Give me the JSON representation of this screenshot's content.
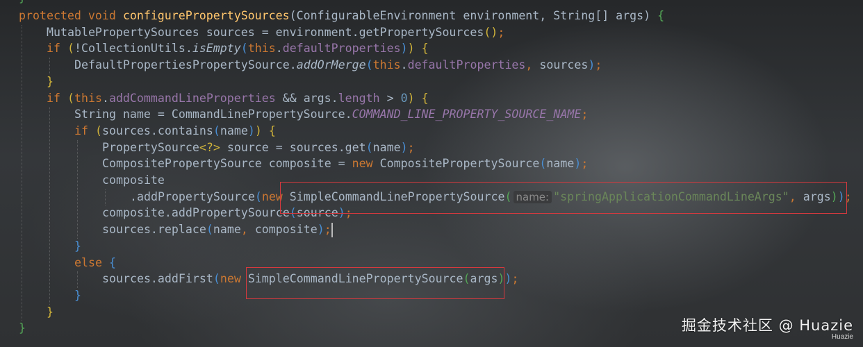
{
  "editor": {
    "top_fragment": "}",
    "lines": [
      {
        "indent": 0,
        "tokens": [
          {
            "t": "protected ",
            "k": "keyword"
          },
          {
            "t": "void ",
            "k": "keyword"
          },
          {
            "t": "configurePropertySources",
            "k": "method"
          },
          {
            "t": "(ConfigurableEnvironment environment, String[] args) ",
            "k": "plain"
          },
          {
            "t": "{",
            "k": "brace-g"
          }
        ]
      },
      {
        "indent": 1,
        "tokens": [
          {
            "t": "MutablePropertySources sources = environment.getPropertySources",
            "k": "plain"
          },
          {
            "t": "()",
            "k": "brace-y"
          },
          {
            "t": ";",
            "k": "keyword"
          }
        ]
      },
      {
        "indent": 1,
        "tokens": [
          {
            "t": "if ",
            "k": "keyword"
          },
          {
            "t": "(",
            "k": "brace-y"
          },
          {
            "t": "!CollectionUtils.",
            "k": "plain"
          },
          {
            "t": "isEmpty",
            "k": "static-call"
          },
          {
            "t": "(",
            "k": "brace-b"
          },
          {
            "t": "this",
            "k": "keyword"
          },
          {
            "t": ".",
            "k": "plain"
          },
          {
            "t": "defaultProperties",
            "k": "field"
          },
          {
            "t": ")",
            "k": "brace-b"
          },
          {
            "t": ")",
            "k": "brace-y"
          },
          {
            "t": " ",
            "k": "plain"
          },
          {
            "t": "{",
            "k": "brace-y"
          }
        ]
      },
      {
        "indent": 2,
        "tokens": [
          {
            "t": "DefaultPropertiesPropertySource.",
            "k": "plain"
          },
          {
            "t": "addOrMerge",
            "k": "static-call"
          },
          {
            "t": "(",
            "k": "brace-b"
          },
          {
            "t": "this",
            "k": "keyword"
          },
          {
            "t": ".",
            "k": "plain"
          },
          {
            "t": "defaultProperties",
            "k": "field"
          },
          {
            "t": ", ",
            "k": "keyword"
          },
          {
            "t": "sources",
            "k": "plain"
          },
          {
            "t": ")",
            "k": "brace-b"
          },
          {
            "t": ";",
            "k": "keyword"
          }
        ]
      },
      {
        "indent": 1,
        "tokens": [
          {
            "t": "}",
            "k": "brace-y"
          }
        ]
      },
      {
        "indent": 1,
        "tokens": [
          {
            "t": "if ",
            "k": "keyword"
          },
          {
            "t": "(",
            "k": "brace-y"
          },
          {
            "t": "this",
            "k": "keyword"
          },
          {
            "t": ".",
            "k": "plain"
          },
          {
            "t": "addCommandLineProperties",
            "k": "field"
          },
          {
            "t": " && args.",
            "k": "plain"
          },
          {
            "t": "length",
            "k": "field"
          },
          {
            "t": " > ",
            "k": "plain"
          },
          {
            "t": "0",
            "k": "number"
          },
          {
            "t": ")",
            "k": "brace-y"
          },
          {
            "t": " ",
            "k": "plain"
          },
          {
            "t": "{",
            "k": "brace-y"
          }
        ]
      },
      {
        "indent": 2,
        "tokens": [
          {
            "t": "String name = CommandLinePropertySource.",
            "k": "plain"
          },
          {
            "t": "COMMAND_LINE_PROPERTY_SOURCE_NAME",
            "k": "field-static"
          },
          {
            "t": ";",
            "k": "keyword"
          }
        ]
      },
      {
        "indent": 2,
        "tokens": [
          {
            "t": "if ",
            "k": "keyword"
          },
          {
            "t": "(",
            "k": "brace-y"
          },
          {
            "t": "sources.contains",
            "k": "plain"
          },
          {
            "t": "(",
            "k": "brace-b"
          },
          {
            "t": "name",
            "k": "plain"
          },
          {
            "t": ")",
            "k": "brace-b"
          },
          {
            "t": ")",
            "k": "brace-y"
          },
          {
            "t": " ",
            "k": "plain"
          },
          {
            "t": "{",
            "k": "brace-y"
          }
        ]
      },
      {
        "indent": 3,
        "tokens": [
          {
            "t": "PropertySource",
            "k": "plain"
          },
          {
            "t": "<?>",
            "k": "brace-y"
          },
          {
            "t": " source = sources.get",
            "k": "plain"
          },
          {
            "t": "(",
            "k": "brace-b"
          },
          {
            "t": "name",
            "k": "plain"
          },
          {
            "t": ")",
            "k": "brace-b"
          },
          {
            "t": ";",
            "k": "keyword"
          }
        ]
      },
      {
        "indent": 3,
        "tokens": [
          {
            "t": "CompositePropertySource composite = ",
            "k": "plain"
          },
          {
            "t": "new ",
            "k": "keyword"
          },
          {
            "t": "CompositePropertySource",
            "k": "plain"
          },
          {
            "t": "(",
            "k": "brace-b"
          },
          {
            "t": "name",
            "k": "plain"
          },
          {
            "t": ")",
            "k": "brace-b"
          },
          {
            "t": ";",
            "k": "keyword"
          }
        ]
      },
      {
        "indent": 3,
        "tokens": [
          {
            "t": "composite",
            "k": "plain"
          }
        ]
      },
      {
        "indent": 4,
        "tokens": [
          {
            "t": ".addPropertySource",
            "k": "plain"
          },
          {
            "t": "(",
            "k": "brace-b"
          },
          {
            "t": "new ",
            "k": "keyword"
          },
          {
            "t": "SimpleCommandLinePropertySource",
            "k": "plain"
          },
          {
            "t": "(",
            "k": "brace-g"
          },
          {
            "t": "name:",
            "k": "hint"
          },
          {
            "t": "\"springApplicationCommandLineArgs\"",
            "k": "string"
          },
          {
            "t": ", ",
            "k": "keyword"
          },
          {
            "t": "args",
            "k": "plain"
          },
          {
            "t": ")",
            "k": "brace-g"
          },
          {
            "t": ")",
            "k": "brace-b"
          },
          {
            "t": ";",
            "k": "keyword"
          }
        ]
      },
      {
        "indent": 3,
        "tokens": [
          {
            "t": "composite.addPropertySource",
            "k": "plain"
          },
          {
            "t": "(",
            "k": "brace-b"
          },
          {
            "t": "source",
            "k": "plain"
          },
          {
            "t": ")",
            "k": "brace-b"
          },
          {
            "t": ";",
            "k": "keyword"
          }
        ]
      },
      {
        "indent": 3,
        "tokens": [
          {
            "t": "sources.replace",
            "k": "plain"
          },
          {
            "t": "(",
            "k": "brace-b"
          },
          {
            "t": "name",
            "k": "plain"
          },
          {
            "t": ", ",
            "k": "keyword"
          },
          {
            "t": "composite",
            "k": "plain"
          },
          {
            "t": ")",
            "k": "brace-b"
          },
          {
            "t": ";",
            "k": "keyword"
          }
        ]
      },
      {
        "indent": 2,
        "tokens": [
          {
            "t": "}",
            "k": "brace-b"
          }
        ]
      },
      {
        "indent": 2,
        "tokens": [
          {
            "t": "else ",
            "k": "keyword"
          },
          {
            "t": "{",
            "k": "brace-b"
          }
        ]
      },
      {
        "indent": 3,
        "tokens": [
          {
            "t": "sources.addFirst",
            "k": "plain"
          },
          {
            "t": "(",
            "k": "brace-b"
          },
          {
            "t": "new ",
            "k": "keyword"
          },
          {
            "t": "SimpleCommandLinePropertySource",
            "k": "plain"
          },
          {
            "t": "(",
            "k": "brace-g"
          },
          {
            "t": "args",
            "k": "plain"
          },
          {
            "t": ")",
            "k": "brace-g"
          },
          {
            "t": ")",
            "k": "brace-b"
          },
          {
            "t": ";",
            "k": "keyword"
          }
        ]
      },
      {
        "indent": 2,
        "tokens": [
          {
            "t": "}",
            "k": "brace-b"
          }
        ]
      },
      {
        "indent": 1,
        "tokens": [
          {
            "t": "}",
            "k": "brace-y"
          }
        ]
      },
      {
        "indent": 0,
        "tokens": [
          {
            "t": "}",
            "k": "brace-g"
          }
        ]
      }
    ]
  },
  "annotations": {
    "highlight_color": "#d6393e"
  },
  "watermark": {
    "main": "掘金技术社区 @ Huazie",
    "sub": "Huazie"
  },
  "colors": {
    "keyword": "#cc7832",
    "method": "#ffc66d",
    "field": "#9876aa",
    "string": "#6a8759",
    "number": "#6897bb",
    "plain": "#a9b7c6"
  }
}
